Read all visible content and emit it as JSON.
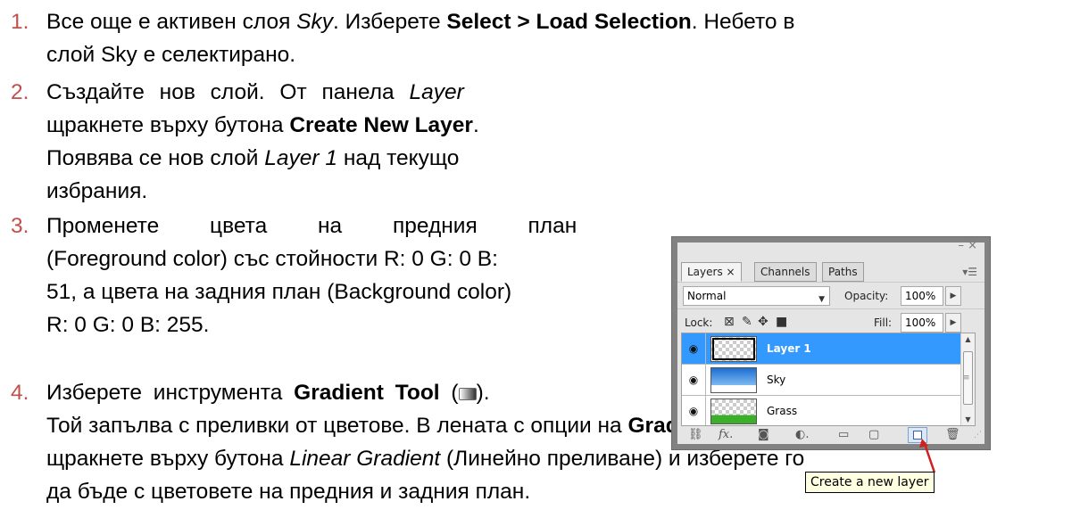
{
  "steps": [
    {
      "num": "1.",
      "lines": [
        [
          "Все още е активен слоя ",
          {
            "i": "Sky"
          },
          ". Изберете ",
          {
            "b": "Select > Load Selection"
          },
          ". Небето в"
        ],
        [
          "слой Sky е селектирано."
        ]
      ]
    },
    {
      "num": "2.",
      "lines": [
        [
          "Създайте нов слой. От панела ",
          {
            "i": "Layer"
          }
        ],
        [
          "щракнете върху бутона ",
          {
            "b": "Create New Layer"
          },
          "."
        ],
        [
          "Появява се нов слой ",
          {
            "i": "Layer 1"
          },
          " над текущо"
        ],
        [
          "избрания."
        ]
      ]
    },
    {
      "num": "3.",
      "lines": [
        [
          "Променете цвета на предния план"
        ],
        [
          "(Foreground color) със стойности R: 0 G: 0 B:"
        ],
        [
          "51, а цвета на задния план (Background color)"
        ],
        [
          "R: 0 G: 0 B: 255."
        ]
      ]
    },
    {
      "num": "4.",
      "lines": [
        [
          "Изберете инструмента ",
          {
            "b": "Gradient Tool"
          },
          " (",
          {
            "icon": "gradient-tool-icon"
          },
          ")."
        ],
        [
          "Той запълва с преливки от цветове. В лената с опции на ",
          {
            "b": "Gradient Tool"
          }
        ],
        [
          "щракнете върху бутона ",
          {
            "i": "Linear Gradient"
          },
          " (Линейно преливане) и изберете го"
        ],
        [
          "да бъде с цветовете на предния и задния план."
        ]
      ]
    }
  ],
  "panel": {
    "window_controls": "– ×",
    "tabs": [
      "Layers ×",
      "Channels",
      "Paths"
    ],
    "blend_mode": "Normal",
    "opacity_label": "Opacity:",
    "opacity_value": "100%",
    "lock_label": "Lock:",
    "fill_label": "Fill:",
    "fill_value": "100%",
    "layers": [
      {
        "name": "Layer 1",
        "selected": true,
        "thumb": "transparent"
      },
      {
        "name": "Sky",
        "selected": false,
        "thumb": "sky"
      },
      {
        "name": "Grass",
        "selected": false,
        "thumb": "grass"
      }
    ],
    "tooltip": "Create a new layer"
  },
  "colors": {
    "step_number": "#c0504d",
    "selection": "#3399ff",
    "tooltip_bg": "#ffffe1"
  }
}
